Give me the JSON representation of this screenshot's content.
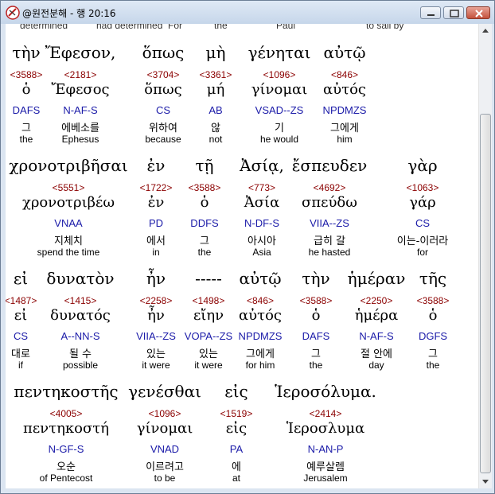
{
  "window": {
    "title": "@원전분해 - 행 20:16",
    "minimize_label": "minimize",
    "maximize_label": "maximize",
    "close_label": "close"
  },
  "top_strip": {
    "items": [
      "determined",
      "had determined",
      "For",
      "the",
      "Paul",
      "to sail by"
    ]
  },
  "blocks": [
    {
      "words": [
        {
          "greek": "τὴν",
          "strong": "<3588>",
          "lemma": "ὁ",
          "morph": "DAFS",
          "korean": "그",
          "english": "the"
        },
        {
          "greek": "Ἔφεσον,",
          "strong": "<2181>",
          "lemma": "Ἔφεσος",
          "morph": "N-AF-S",
          "korean": "에베소를",
          "english": "Ephesus"
        },
        {
          "greek": "ὅπως",
          "strong": "<3704>",
          "lemma": "ὅπως",
          "morph": "CS",
          "korean": "위하여",
          "english": "because"
        },
        {
          "greek": "μὴ",
          "strong": "<3361>",
          "lemma": "μή",
          "morph": "AB",
          "korean": "않",
          "english": "not"
        },
        {
          "greek": "γένηται",
          "strong": "<1096>",
          "lemma": "γίνομαι",
          "morph": "VSAD--ZS",
          "korean": "기",
          "english": "he would"
        },
        {
          "greek": "αὐτῷ",
          "strong": "<846>",
          "lemma": "αὐτός",
          "morph": "NPDMZS",
          "korean": "그에게",
          "english": "him"
        }
      ]
    },
    {
      "words": [
        {
          "greek": "χρονοτριβῆσαι",
          "strong": "<5551>",
          "lemma": "χρονοτριβέω",
          "morph": "VNAA",
          "korean": "지체치",
          "english": "spend the time"
        },
        {
          "greek": "ἐν",
          "strong": "<1722>",
          "lemma": "ἐν",
          "morph": "PD",
          "korean": "에서",
          "english": "in"
        },
        {
          "greek": "τῇ",
          "strong": "<3588>",
          "lemma": "ὁ",
          "morph": "DDFS",
          "korean": "그",
          "english": "the"
        },
        {
          "greek": "Ἀσίᾳ,",
          "strong": "<773>",
          "lemma": "Ἀσία",
          "morph": "N-DF-S",
          "korean": "아시아",
          "english": "Asia"
        },
        {
          "greek": "ἔσπευδεν",
          "strong": "<4692>",
          "lemma": "σπεύδω",
          "morph": "VIIA--ZS",
          "korean": "급히 갈",
          "english": "he hasted"
        },
        {
          "greek": "γὰρ",
          "strong": "<1063>",
          "lemma": "γάρ",
          "morph": "CS",
          "korean": "이는-이러라",
          "english": "for"
        }
      ]
    },
    {
      "words": [
        {
          "greek": "εἰ",
          "strong": "<1487>",
          "lemma": "εἰ",
          "morph": "CS",
          "korean": "대로",
          "english": "if"
        },
        {
          "greek": "δυνατὸν",
          "strong": "<1415>",
          "lemma": "δυνατός",
          "morph": "A--NN-S",
          "korean": "될 수",
          "english": "possible"
        },
        {
          "greek": "ἦν",
          "strong": "<2258>",
          "lemma": "ἦν",
          "morph": "VIIA--ZS",
          "korean": "있는",
          "english": "it were"
        },
        {
          "greek": "-----",
          "strong": "<1498>",
          "lemma": "εἴην",
          "morph": "VOPA--ZS",
          "korean": "있는",
          "english": "it were"
        },
        {
          "greek": "αὐτῷ",
          "strong": "<846>",
          "lemma": "αὐτός",
          "morph": "NPDMZS",
          "korean": "그에게",
          "english": "for him"
        },
        {
          "greek": "τὴν",
          "strong": "<3588>",
          "lemma": "ὁ",
          "morph": "DAFS",
          "korean": "그",
          "english": "the"
        },
        {
          "greek": "ἡμέραν",
          "strong": "<2250>",
          "lemma": "ἡμέρα",
          "morph": "N-AF-S",
          "korean": "절 안에",
          "english": "day"
        },
        {
          "greek": "τῆς",
          "strong": "<3588>",
          "lemma": "ὁ",
          "morph": "DGFS",
          "korean": "그",
          "english": "the"
        }
      ]
    },
    {
      "words": [
        {
          "greek": "πεντηκοστῆς",
          "strong": "<4005>",
          "lemma": "πεντηκοστή",
          "morph": "N-GF-S",
          "korean": "오순",
          "english": "of Pentecost"
        },
        {
          "greek": "γενέσθαι",
          "strong": "<1096>",
          "lemma": "γίνομαι",
          "morph": "VNAD",
          "korean": "이르려고",
          "english": "to be"
        },
        {
          "greek": "εἰς",
          "strong": "<1519>",
          "lemma": "εἰς",
          "morph": "PA",
          "korean": "에",
          "english": "at"
        },
        {
          "greek": "Ἱεροσόλυμα.",
          "strong": "<2414>",
          "lemma": "Ἱεροσλυμα",
          "morph": "N-AN-P",
          "korean": "예루살렘",
          "english": "Jerusalem"
        }
      ]
    }
  ],
  "colors": {
    "strong_number": "#8b0000",
    "morphology": "#1a1aa8",
    "text": "#000000"
  }
}
